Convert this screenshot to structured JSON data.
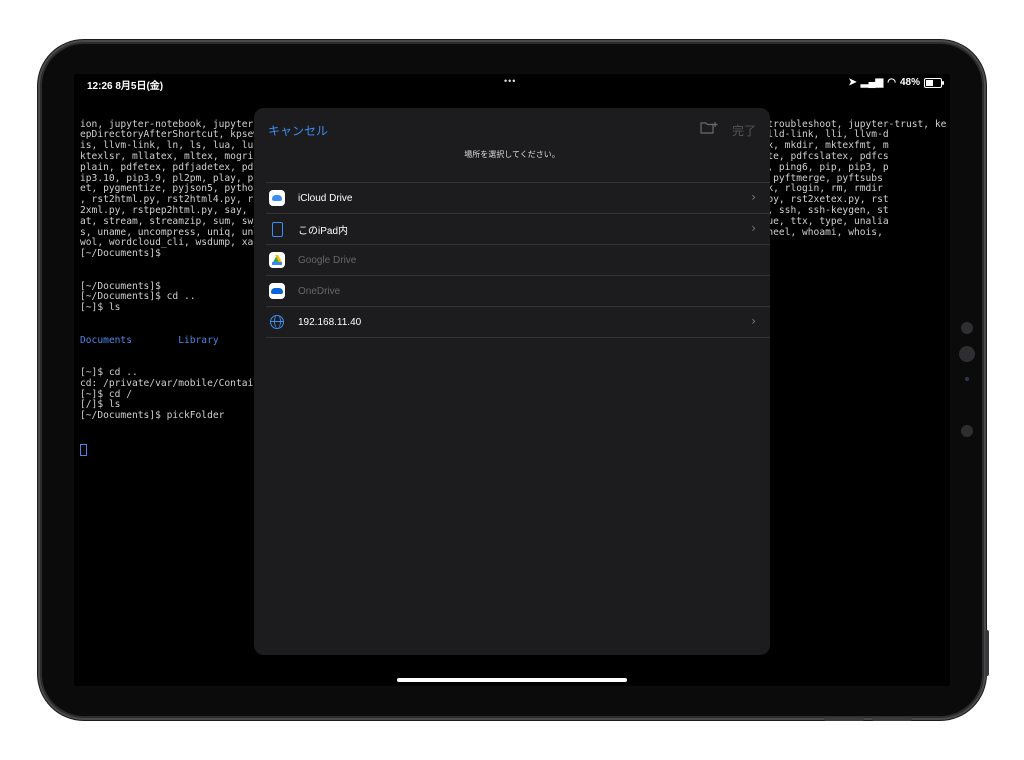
{
  "status_bar": {
    "time": "12:26 8月5日(金)",
    "dots": "•••",
    "battery": "48%",
    "battery_level": 0.48
  },
  "terminal": {
    "lines": [
      "ion, jupyter-notebook, jupyter-qtconsole, jupyter-retro, jupyter-run, jupyter-server, jupyter-serverextension, jupyter-troubleshoot, jupyter-trust, ke",
      "epDirectoryAfterShortcut, kpsewhich, ...                                                                      lc, lld, lld-link, lli, llvm-d",
      "is, llvm-link, ln, ls, lua, luatex, ...                                                                       , md5, mex, mkdir, mktexfmt, m",
      "ktexlsr, mllatex, mltex, mogrify, ...                                                                         py, pbpaste, pdfcslatex, pdfcs",
      "plain, pdfetex, pdfjadetex, pdflatex, ...                                                                     onv, ping, ping6, pip, pip3, p",
      "ip3.10, pip3.9, pl2pm, play, pod2html, ...                                                                    pydoc3.9, pyftmerge, pyftsubs",
      "et, pygmentize, pyjson5, python3, ...                                                                         renamemark, rlogin, rm, rmdir",
      ", rst2html.py, rst2html4.py, rst2html5.py, ...                                                                , rst2s5.py, rst2xetex.py, rst",
      "2xml.py, rstpep2html.py, say, scp, ...                                                                        e, splain, ssh, ssh-keygen, st",
      "at, stream, streamzip, sum, sw_vers, ...                                                                       tree, true, ttx, type, unalia",
      "s, uname, uncompress, uniq, unzip, ...                                                                        whatis, wheel, whoami, whois,",
      "wol, wordcloud_cli, wsdump, xargs, ...",
      "[~/Documents]$",
      "",
      "",
      "[~/Documents]$",
      "[~/Documents]$ cd ..",
      "[~]$ ls"
    ],
    "ls_output": "Documents        Library",
    "lines_after": [
      "[~]$ cd ..",
      "cd: /private/var/mobile/Containers/...",
      "[~]$ cd /",
      "[/]$ ls",
      "[~/Documents]$ pickFolder"
    ]
  },
  "picker": {
    "cancel_label": "キャンセル",
    "done_label": "完了",
    "title": "場所を選択してください。",
    "locations": [
      {
        "label": "iCloud Drive",
        "icon": "icloud-icon",
        "enabled": true,
        "chevron": true
      },
      {
        "label": "このiPad内",
        "icon": "ipad-icon",
        "enabled": true,
        "chevron": true
      },
      {
        "label": "Google Drive",
        "icon": "google-drive-icon",
        "enabled": false,
        "chevron": false
      },
      {
        "label": "OneDrive",
        "icon": "onedrive-icon",
        "enabled": false,
        "chevron": false
      },
      {
        "label": "192.168.11.40",
        "icon": "globe-icon",
        "enabled": true,
        "chevron": true
      }
    ]
  },
  "colors": {
    "accent": "#3d8cf0",
    "modal_bg": "#1c1c1e",
    "screen_bg": "#000000"
  }
}
